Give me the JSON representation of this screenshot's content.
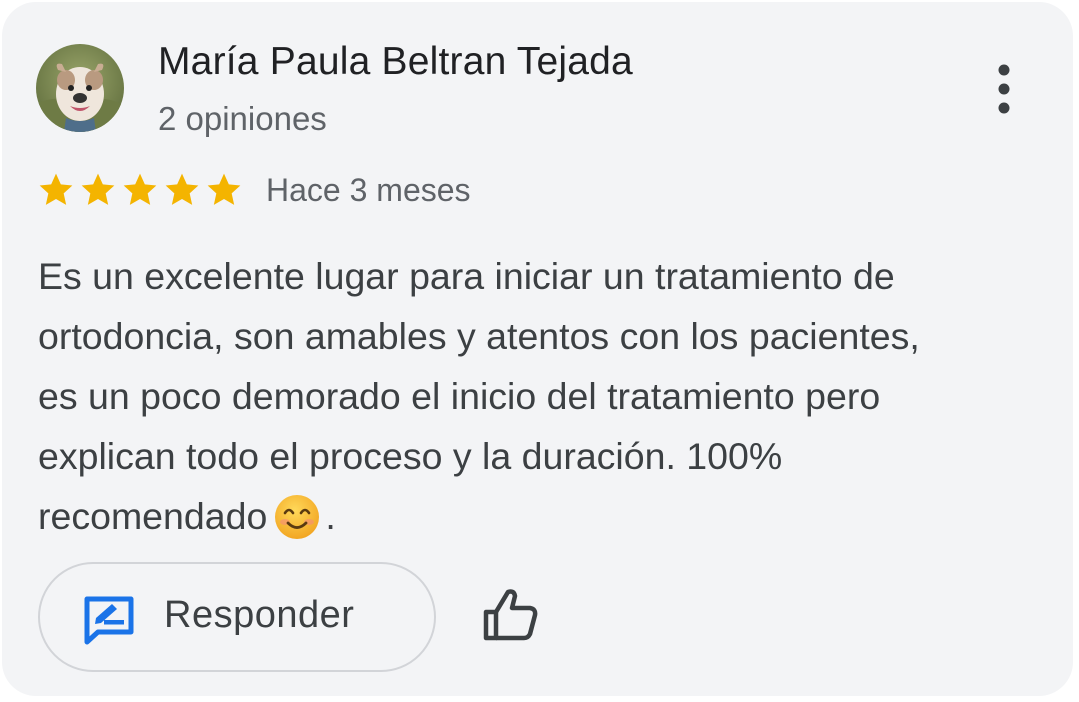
{
  "reviewer": {
    "name": "María Paula Beltran Tejada",
    "review_count": "2 opiniones",
    "avatar_icon": "bulldog-avatar"
  },
  "review": {
    "rating": 5,
    "rating_max": 5,
    "time": "Hace 3 meses",
    "text_lines": [
      "Es un excelente lugar para iniciar un tratamiento de",
      "ortodoncia, son amables y atentos con los pacientes,",
      "es un poco demorado el inicio del tratamiento pero",
      "explican todo el proceso y la duración. 100%",
      "recomendado"
    ],
    "text_end": "."
  },
  "actions": {
    "reply_label": "Responder",
    "reply_icon": "reply-edit-icon",
    "like_icon": "thumbs-up-icon",
    "more_icon": "more-vertical-icon"
  },
  "colors": {
    "star": "#f4b400",
    "reply_icon": "#1a73e8",
    "card_bg": "#f3f4f6"
  }
}
